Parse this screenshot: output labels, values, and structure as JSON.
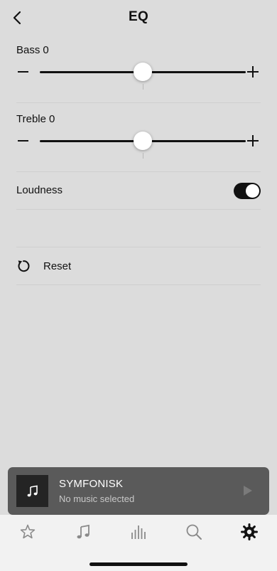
{
  "header": {
    "title": "EQ",
    "back_icon": "chevron-left-icon"
  },
  "bass": {
    "label": "Bass",
    "value": "0",
    "level": 0.5
  },
  "treble": {
    "label": "Treble",
    "value": "0",
    "level": 0.5
  },
  "loudness": {
    "label": "Loudness",
    "enabled": true
  },
  "reset": {
    "label": "Reset",
    "icon": "reset-icon"
  },
  "miniplayer": {
    "title": "SYMFONISK",
    "subtitle": "No music selected",
    "art_icon": "music-note-icon",
    "play_icon": "play-icon"
  },
  "tabs": [
    {
      "icon": "star-icon",
      "name": "favorites",
      "active": false
    },
    {
      "icon": "music-note-icon",
      "name": "music",
      "active": false
    },
    {
      "icon": "equalizer-icon",
      "name": "rooms",
      "active": false
    },
    {
      "icon": "search-icon",
      "name": "search",
      "active": false
    },
    {
      "icon": "gear-icon",
      "name": "settings",
      "active": true
    }
  ],
  "colors": {
    "background": "#dcdcdc",
    "accent": "#111111",
    "tabbar": "#f2f2f2",
    "miniplayer": "#5a5a5a"
  }
}
